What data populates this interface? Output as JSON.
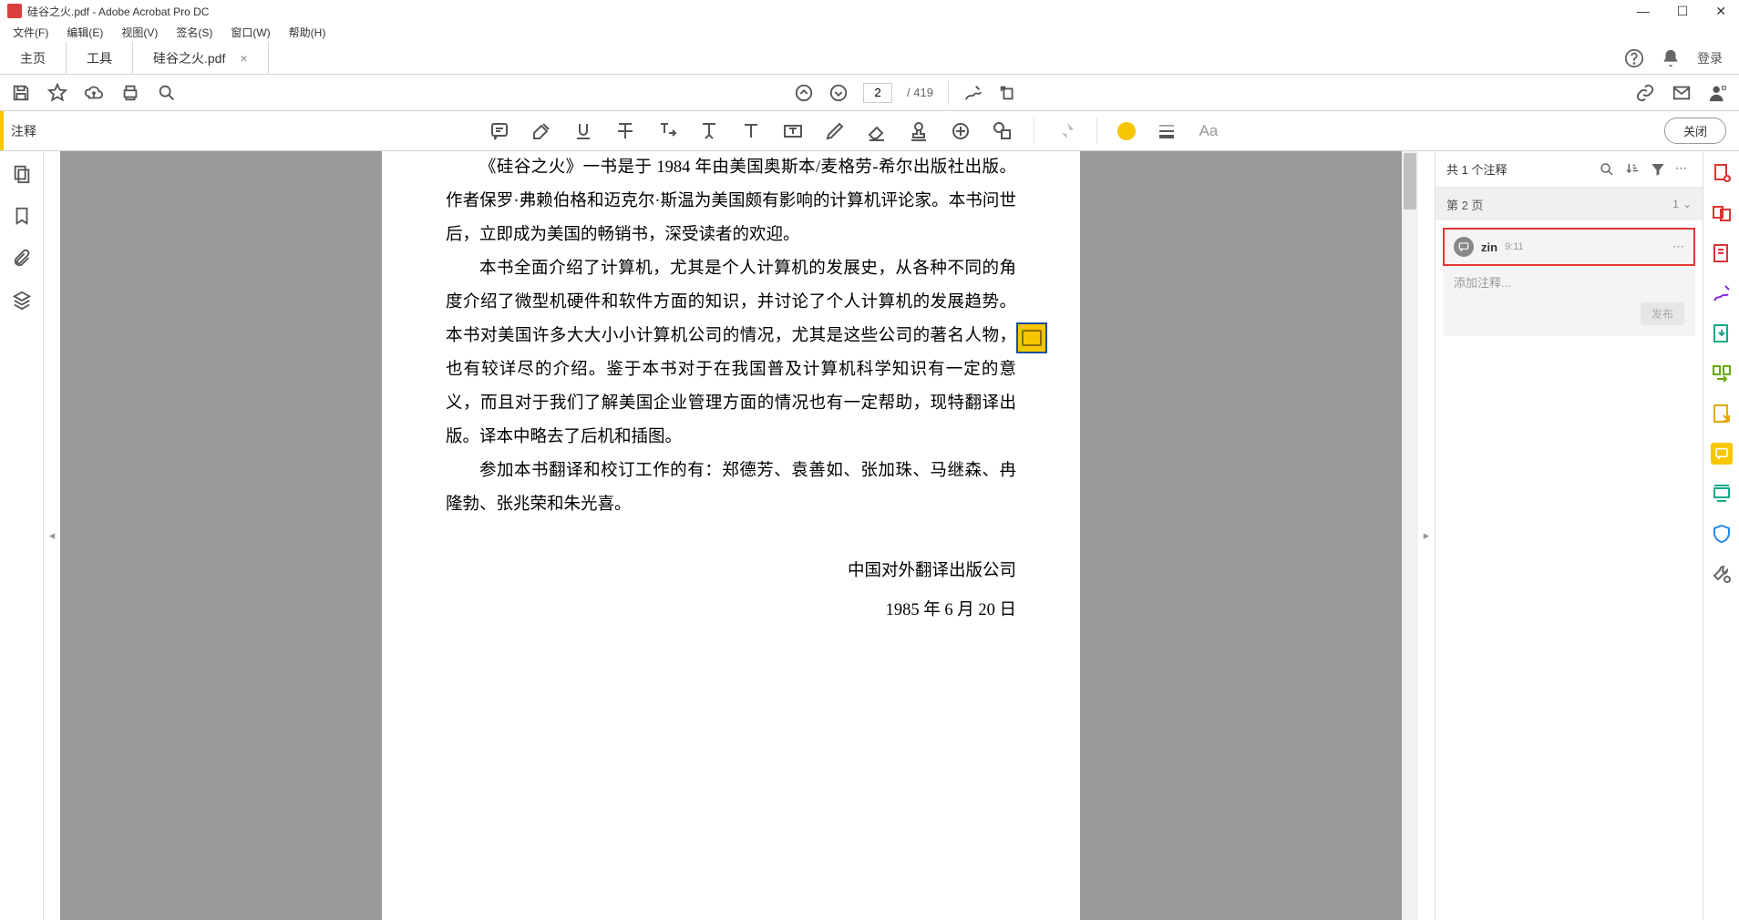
{
  "window": {
    "title": "硅谷之火.pdf - Adobe Acrobat Pro DC"
  },
  "menu": {
    "file": "文件(F)",
    "edit": "编辑(E)",
    "view": "视图(V)",
    "sign": "签名(S)",
    "window": "窗口(W)",
    "help": "帮助(H)"
  },
  "tabs": {
    "home": "主页",
    "tools": "工具",
    "doc": "硅谷之火.pdf",
    "login": "登录"
  },
  "page_nav": {
    "current": "2",
    "total": "/ 419"
  },
  "annot_bar": {
    "label": "注释",
    "close": "关闭",
    "font_sample": "Aa"
  },
  "document": {
    "p1": "《硅谷之火》一书是于 1984 年由美国奥斯本/麦格劳-希尔出版社出版。作者保罗·弗赖伯格和迈克尔·斯温为美国颇有影响的计算机评论家。本书问世后，立即成为美国的畅销书，深受读者的欢迎。",
    "p2": "本书全面介绍了计算机，尤其是个人计算机的发展史，从各种不同的角度介绍了微型机硬件和软件方面的知识，并讨论了个人计算机的发展趋势。本书对美国许多大大小小计算机公司的情况，尤其是这些公司的著名人物，也有较详尽的介绍。鉴于本书对于在我国普及计算机科学知识有一定的意义，而且对于我们了解美国企业管理方面的情况也有一定帮助，现特翻译出版。译本中略去了后机和插图。",
    "p3": "参加本书翻译和校订工作的有：郑德芳、袁善如、张加珠、马继森、冉隆勃、张兆荣和朱光喜。",
    "pub": "中国对外翻译出版公司",
    "date": "1985 年 6 月 20 日"
  },
  "comments": {
    "title": "共 1 个注释",
    "page_label": "第 2 页",
    "page_count": "1",
    "item": {
      "author": "zin",
      "time": "9:11",
      "placeholder": "添加注释...",
      "publish": "发布"
    }
  }
}
